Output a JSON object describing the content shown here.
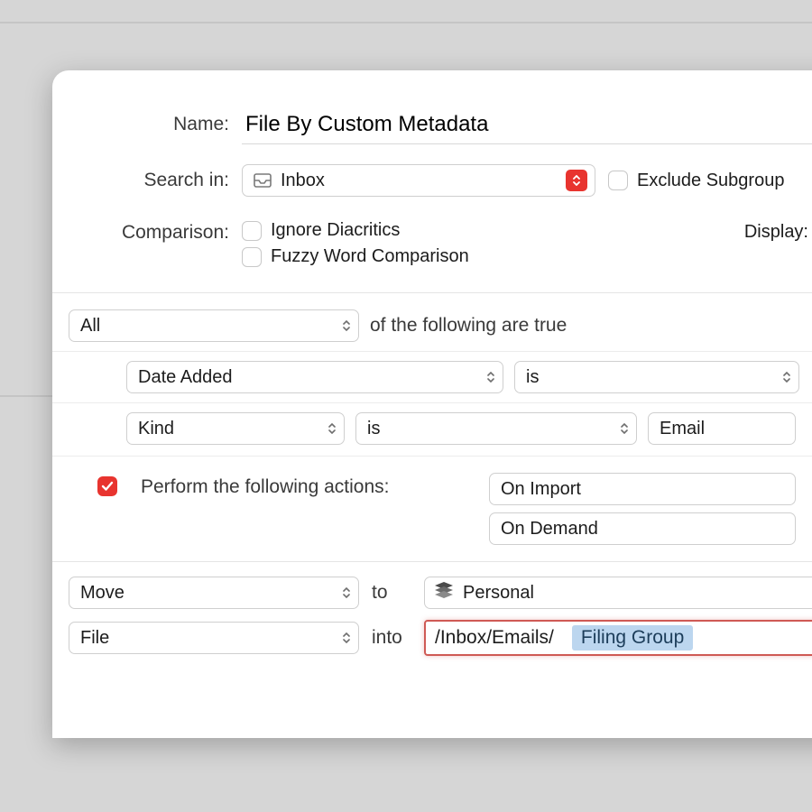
{
  "header": {
    "name_label": "Name:",
    "name_value": "File By Custom Metadata",
    "searchin_label": "Search in:",
    "searchin_value": "Inbox",
    "exclude_label": "Exclude Subgroup",
    "comparison_label": "Comparison:",
    "ignore_diacritics_label": "Ignore Diacritics",
    "fuzzy_label": "Fuzzy Word Comparison",
    "display_label": "Display:"
  },
  "rules": {
    "combiner": "All",
    "combiner_suffix": "of the following are true",
    "r1_field": "Date Added",
    "r1_op": "is",
    "r2_field": "Kind",
    "r2_op": "is",
    "r2_value": "Email"
  },
  "actions": {
    "perform_label": "Perform the following actions:",
    "trigger1": "On Import",
    "trigger2": "On Demand"
  },
  "bottom": {
    "act1": "Move",
    "to": "to",
    "dest1": "Personal",
    "act2": "File",
    "into": "into",
    "path": "/Inbox/Emails/",
    "token": "Filing Group"
  },
  "icons": {
    "inbox": "inbox-icon",
    "stack": "database-stack-icon"
  }
}
